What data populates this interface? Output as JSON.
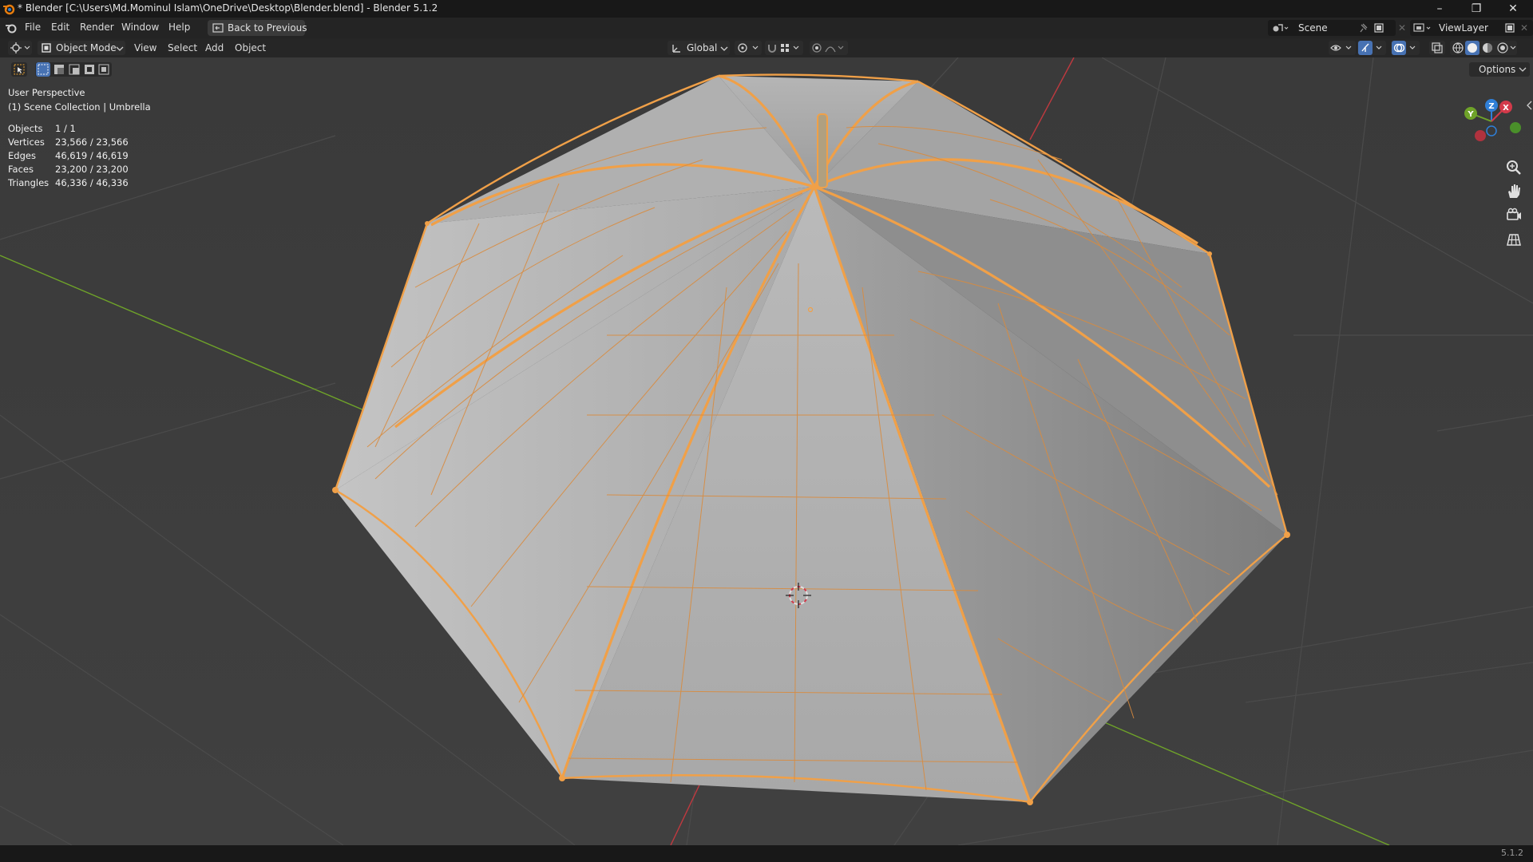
{
  "window": {
    "title": "* Blender [C:\\Users\\Md.Mominul Islam\\OneDrive\\Desktop\\Blender.blend] - Blender 5.1.2",
    "minimize": "–",
    "restore": "❐",
    "close": "✕"
  },
  "menubar": {
    "items": [
      "File",
      "Edit",
      "Render",
      "Window",
      "Help"
    ],
    "back_button": "Back to Previous",
    "scene": "Scene",
    "view_layer": "ViewLayer"
  },
  "header": {
    "mode": "Object Mode",
    "menus": [
      "View",
      "Select",
      "Add",
      "Object"
    ],
    "orientation": "Global",
    "options": "Options"
  },
  "overlay": {
    "perspective": "User Perspective",
    "collection": "(1) Scene Collection | Umbrella",
    "stats": [
      {
        "label": "Objects",
        "value": "1 / 1"
      },
      {
        "label": "Vertices",
        "value": "23,566 / 23,566"
      },
      {
        "label": "Edges",
        "value": "46,619 / 46,619"
      },
      {
        "label": "Faces",
        "value": "23,200 / 23,200"
      },
      {
        "label": "Triangles",
        "value": "46,336 / 46,336"
      }
    ]
  },
  "gizmo": {
    "x": "X",
    "y": "Y",
    "z": "Z"
  },
  "colors": {
    "selection": "#f0a048",
    "x_axis": "#d33a4a",
    "y_axis": "#6fa329",
    "z_axis": "#2f7fd7"
  },
  "status": {
    "version": "5.1.2"
  }
}
